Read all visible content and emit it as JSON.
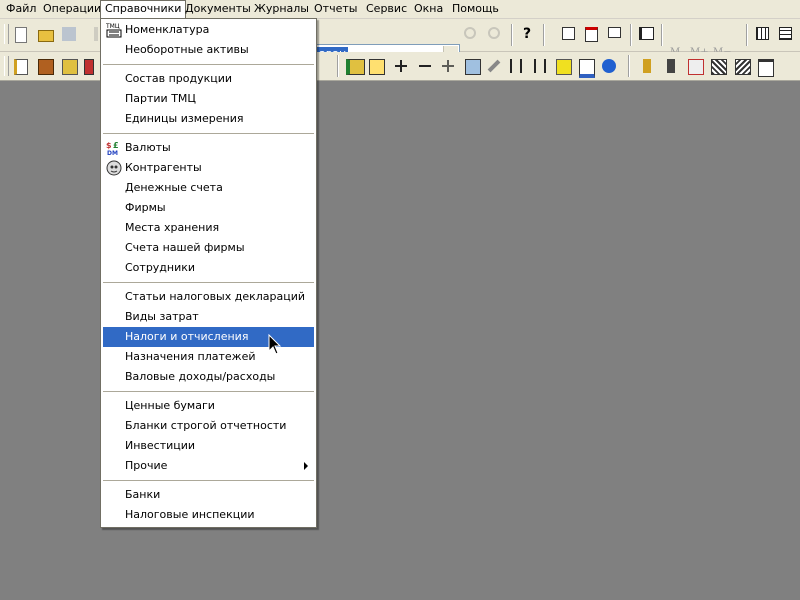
{
  "menubar": {
    "items": [
      {
        "id": "file",
        "label": "Файл"
      },
      {
        "id": "operations",
        "label": "Операции"
      },
      {
        "id": "references",
        "label": "Справочники"
      },
      {
        "id": "documents",
        "label": "Документы"
      },
      {
        "id": "journals",
        "label": "Журналы"
      },
      {
        "id": "reports",
        "label": "Отчеты"
      },
      {
        "id": "service",
        "label": "Сервис"
      },
      {
        "id": "windows",
        "label": "Окна"
      },
      {
        "id": "help",
        "label": "Помощь"
      }
    ],
    "open_item": "references"
  },
  "toolbar": {
    "combo_value": "аван",
    "m_labels": [
      "M",
      "M+",
      "M−"
    ]
  },
  "menu": {
    "items": [
      {
        "label": "Номенклатура",
        "icon": "tmc-list-icon"
      },
      {
        "label": "Необоротные активы"
      },
      {
        "label": "Состав продукции"
      },
      {
        "label": "Партии ТМЦ"
      },
      {
        "label": "Единицы измерения"
      },
      {
        "label": "Валюты",
        "icon": "currency-icon"
      },
      {
        "label": "Контрагенты",
        "icon": "contractors-icon"
      },
      {
        "label": "Денежные счета"
      },
      {
        "label": "Фирмы"
      },
      {
        "label": "Места хранения"
      },
      {
        "label": "Счета нашей фирмы"
      },
      {
        "label": "Сотрудники"
      },
      {
        "label": "Статьи налоговых деклараций"
      },
      {
        "label": "Виды затрат"
      },
      {
        "label": "Налоги и отчисления",
        "highlighted": true
      },
      {
        "label": "Назначения платежей"
      },
      {
        "label": "Валовые доходы/расходы"
      },
      {
        "label": "Ценные бумаги"
      },
      {
        "label": "Бланки строгой отчетности"
      },
      {
        "label": "Инвестиции"
      },
      {
        "label": "Прочие",
        "submenu": true
      },
      {
        "label": "Банки"
      },
      {
        "label": "Налоговые инспекции"
      }
    ]
  },
  "colors": {
    "workspace": "#808080",
    "menu_highlight": "#316ac5",
    "chrome": "#ece9d8"
  }
}
